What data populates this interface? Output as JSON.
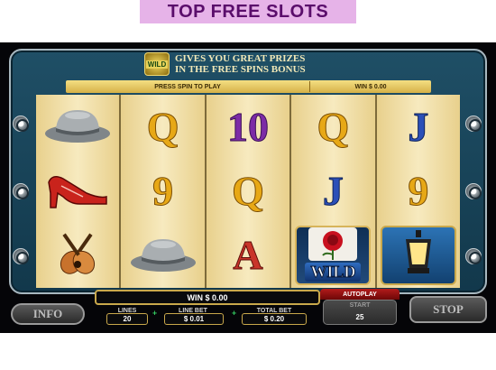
{
  "banner": {
    "text": "TOP FREE SLOTS"
  },
  "top_message": {
    "badge": "WILD",
    "line1": "GIVES YOU GREAT PRIZES",
    "line2": "IN THE FREE SPINS BONUS"
  },
  "status": {
    "prompt": "PRESS SPIN TO PLAY",
    "win": "WIN $ 0.00"
  },
  "reels": [
    [
      {
        "type": "icon",
        "name": "gray-hat-icon"
      },
      {
        "type": "icon",
        "name": "red-shoe-icon"
      },
      {
        "type": "icon",
        "name": "guitars-icon"
      }
    ],
    [
      {
        "type": "letter",
        "value": "Q",
        "class": "sym-q"
      },
      {
        "type": "letter",
        "value": "9",
        "class": "sym-nine"
      },
      {
        "type": "icon",
        "name": "gray-hat-icon"
      }
    ],
    [
      {
        "type": "letter",
        "value": "10",
        "class": "sym-ten"
      },
      {
        "type": "letter",
        "value": "Q",
        "class": "sym-q"
      },
      {
        "type": "letter",
        "value": "A",
        "class": "sym-a"
      }
    ],
    [
      {
        "type": "letter",
        "value": "Q",
        "class": "sym-q"
      },
      {
        "type": "letter",
        "value": "J",
        "class": "sym-j"
      },
      {
        "type": "wild",
        "value": "WILD"
      }
    ],
    [
      {
        "type": "letter",
        "value": "J",
        "class": "sym-j"
      },
      {
        "type": "letter",
        "value": "9",
        "class": "sym-nine"
      },
      {
        "type": "icon",
        "name": "street-lamp-icon"
      }
    ]
  ],
  "controls": {
    "win_display": "WIN $ 0.00",
    "info_label": "INFO",
    "lines_label": "LINES",
    "lines_value": "20",
    "line_bet_label": "LINE BET",
    "line_bet_value": "$ 0.01",
    "total_bet_label": "TOTAL BET",
    "total_bet_value": "$ 0.20",
    "autoplay_label": "AUTOPLAY",
    "start_label": "START",
    "start_value": "25",
    "stop_label": "STOP",
    "plus_minus": "+"
  },
  "colors": {
    "frame": "#1f4f66",
    "gold": "#c9a84b",
    "accent_red": "#b31b1b",
    "banner_bg": "#e6b3e8"
  }
}
